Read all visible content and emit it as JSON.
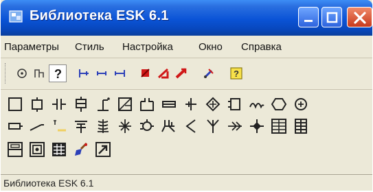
{
  "window": {
    "title": "Библиотека ESK 6.1",
    "icon": "app-library-icon"
  },
  "title_controls": [
    "minimize-icon",
    "maximize-icon",
    "close-icon"
  ],
  "menu": [
    "Параметры",
    "Стиль",
    "Настройка",
    "Окно",
    "Справка"
  ],
  "toolbar": {
    "items": [
      {
        "icon": "target-icon",
        "pressed": false
      },
      {
        "icon": "pin-icon",
        "pressed": false
      },
      {
        "icon": "help-question-icon",
        "pressed": true
      },
      {
        "icon": "connector-left-icon",
        "pressed": false
      },
      {
        "icon": "connector-both-icon",
        "pressed": false
      },
      {
        "icon": "connector-right-icon",
        "pressed": false
      },
      {
        "icon": "red-arrow-1-icon",
        "pressed": false
      },
      {
        "icon": "red-arrow-2-icon",
        "pressed": false
      },
      {
        "icon": "red-arrow-3-icon",
        "pressed": false
      },
      {
        "icon": "tool-pen-icon",
        "pressed": false
      },
      {
        "icon": "yellow-help-icon",
        "pressed": false
      }
    ]
  },
  "palette": {
    "row1": [
      "square-symbol-icon",
      "lamp-symbol-icon",
      "capacitor-symbol-icon",
      "relay-symbol-icon",
      "contact-symbol-icon",
      "switch-box-symbol-icon",
      "socket-symbol-icon",
      "fuse-symbol-icon",
      "plus-symbol-icon",
      "diamond-symbol-icon",
      "coil-symbol-icon",
      "wave-symbol-icon",
      "hexagon-symbol-icon",
      "circle-x-symbol-icon"
    ],
    "row2": [
      "resistor-symbol-icon",
      "line-break-symbol-icon",
      "marker-symbol-icon",
      "ground-symbol-icon",
      "transformer-symbol-icon",
      "breaker-symbol-icon",
      "motor-symbol-icon",
      "cable-symbol-icon",
      "arrow-left-symbol-icon",
      "antenna-symbol-icon",
      "double-arrow-symbol-icon",
      "cross-plus-symbol-icon",
      "grid-box-symbol-icon",
      "terminal-symbol-icon"
    ],
    "row3": [
      "panel-symbol-icon",
      "cabinet-symbol-icon",
      "table-symbol-icon",
      "brush-tool-icon",
      "arrow-box-tool-icon"
    ]
  },
  "status": {
    "text": "Библиотека ESK 6.1"
  },
  "colors": {
    "titlebar": "#0a53d6",
    "face": "#ECE9D8",
    "close": "#c83a1c",
    "icon_blue": "#2b3fb8",
    "icon_red": "#d01818"
  }
}
